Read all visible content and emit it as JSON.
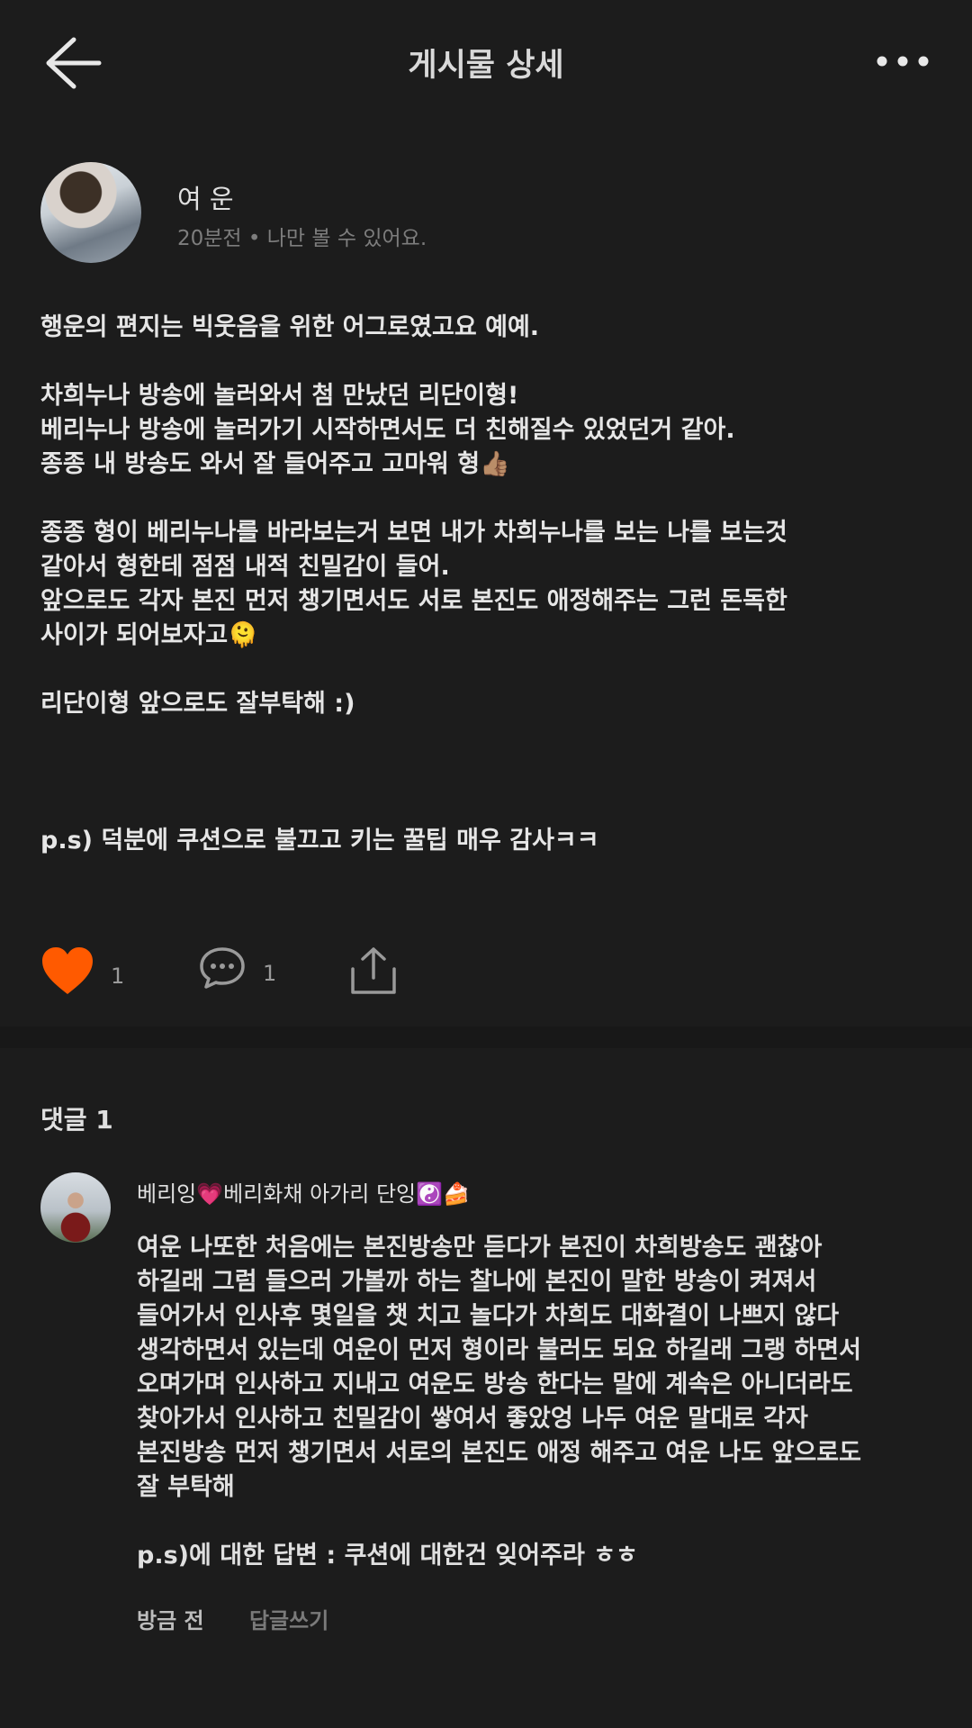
{
  "header": {
    "title": "게시물 상세",
    "back_icon": "arrow-left-icon",
    "more_icon": "more-horizontal-icon"
  },
  "post": {
    "author_name": "여 운",
    "meta": "20분전 • 나만 볼 수 있어요.",
    "lines": [
      "행운의 편지는 빅웃음을 위한 어그로였고요 예예.",
      "",
      "차희누나 방송에 놀러와서 첨 만났던 리단이형!",
      "베리누나 방송에 놀러가기 시작하면서도 더 친해질수 있었던거 같아.",
      "종종 내 방송도 와서 잘 들어주고 고마워 형👍🏽",
      "",
      "종종 형이 베리누나를 바라보는거 보면 내가 차희누나를 보는 나를 보는것",
      "같아서 형한테 점점 내적 친밀감이 들어.",
      "앞으로도 각자 본진 먼저 챙기면서도 서로 본진도 애정해주는 그런 돈독한",
      "사이가 되어보자고🫠",
      "",
      "리단이형 앞으로도 잘부탁해 :)",
      "",
      "",
      "",
      "p.s) 덕분에 쿠션으로 불끄고 키는 꿀팁 매우 감사ㅋㅋ"
    ],
    "like_count": "1",
    "comment_count": "1",
    "like_color": "#ff5a00"
  },
  "comments": {
    "title": "댓글 1",
    "items": [
      {
        "name": "베리잉💗베리화채 아가리 단잉☯️🍰",
        "lines": [
          "여운 나또한 처음에는 본진방송만 듣다가 본진이 차희방송도 괜찮아",
          "하길래 그럼 들으러 가볼까 하는 찰나에 본진이 말한 방송이 켜져서",
          "들어가서 인사후 몇일을 챗 치고 놀다가 차희도 대화결이 나쁘지 않다",
          "생각하면서 있는데 여운이 먼저 형이라 불러도 되요 하길래 그랭 하면서",
          "오며가며 인사하고 지내고 여운도 방송 한다는 말에 계속은 아니더라도",
          "찾아가서 인사하고 친밀감이 쌓여서 좋았엉 나두 여운 말대로 각자",
          "본진방송 먼저 챙기면서 서로의 본진도 애정 해주고 여운 나도 앞으로도",
          "잘 부탁해",
          "",
          "p.s)에 대한 답변 : 쿠션에 대한건 잊어주라 ㅎㅎ"
        ],
        "time": "방금 전",
        "reply_label": "답글쓰기"
      }
    ]
  }
}
